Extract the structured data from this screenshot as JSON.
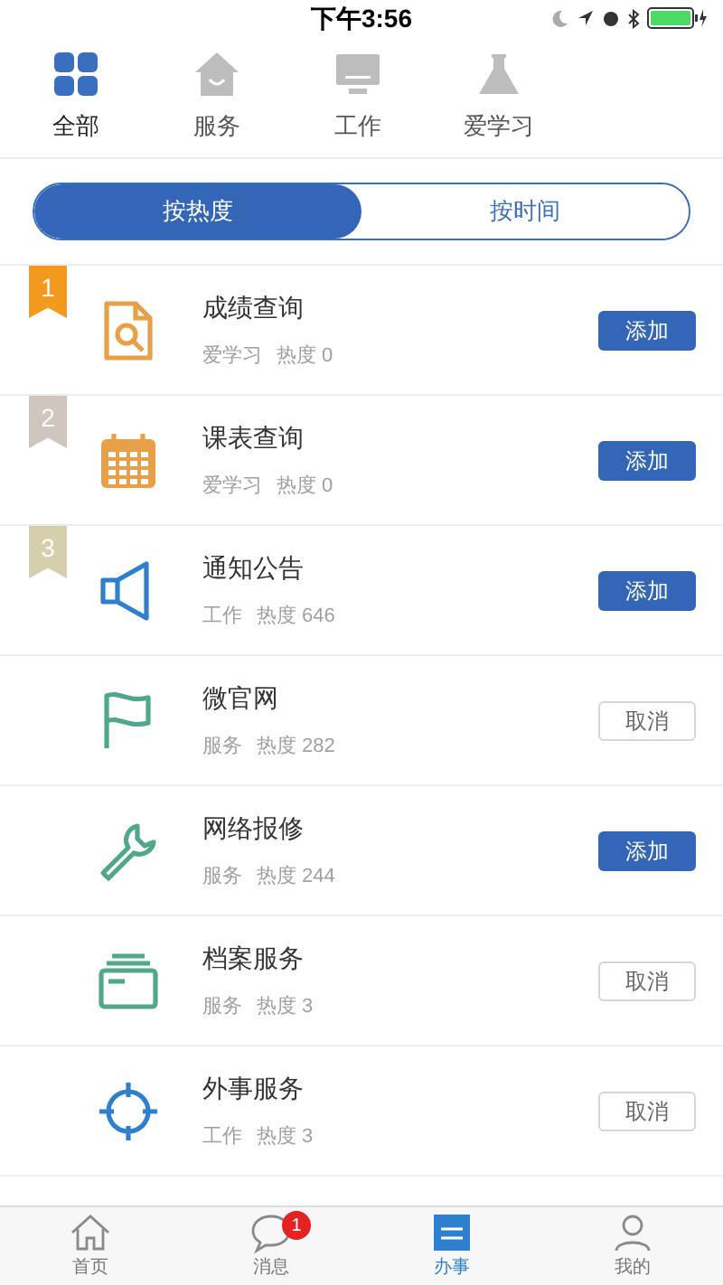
{
  "status_bar": {
    "time": "下午3:56"
  },
  "categories": [
    {
      "label": "全部",
      "kind": "grid",
      "selected": true
    },
    {
      "label": "服务",
      "kind": "house",
      "selected": false
    },
    {
      "label": "工作",
      "kind": "monitor",
      "selected": false
    },
    {
      "label": "爱学习",
      "kind": "flask",
      "selected": false
    }
  ],
  "sort_tabs": [
    {
      "label": "按热度",
      "selected": true
    },
    {
      "label": "按时间",
      "selected": false
    }
  ],
  "items": [
    {
      "rank": {
        "label": "1",
        "color": "#f39a1e"
      },
      "kind": "doc-search",
      "color": "#e8a048",
      "title": "成绩查询",
      "category": "爱学习",
      "heat": "热度 0",
      "button": {
        "label": "添加",
        "added": false
      }
    },
    {
      "rank": {
        "label": "2",
        "color": "#cfc7bd"
      },
      "kind": "calendar",
      "color": "#e8a048",
      "title": "课表查询",
      "category": "爱学习",
      "heat": "热度 0",
      "button": {
        "label": "添加",
        "added": false
      }
    },
    {
      "rank": {
        "label": "3",
        "color": "#d6cfae"
      },
      "kind": "speaker",
      "color": "#2f7fcf",
      "title": "通知公告",
      "category": "工作",
      "heat": "热度 646",
      "button": {
        "label": "添加",
        "added": false
      }
    },
    {
      "kind": "flag",
      "color": "#4fa88a",
      "title": "微官网",
      "category": "服务",
      "heat": "热度 282",
      "button": {
        "label": "取消",
        "added": true
      }
    },
    {
      "kind": "wrench",
      "color": "#4fa88a",
      "title": "网络报修",
      "category": "服务",
      "heat": "热度 244",
      "button": {
        "label": "添加",
        "added": false
      }
    },
    {
      "kind": "archive",
      "color": "#4fa88a",
      "title": "档案服务",
      "category": "服务",
      "heat": "热度 3",
      "button": {
        "label": "取消",
        "added": true
      }
    },
    {
      "kind": "crosshair",
      "color": "#2f7fcf",
      "title": "外事服务",
      "category": "工作",
      "heat": "热度 3",
      "button": {
        "label": "取消",
        "added": true
      }
    }
  ],
  "tab_bar": [
    {
      "label": "首页",
      "kind": "home",
      "selected": false
    },
    {
      "label": "消息",
      "kind": "chat",
      "selected": false,
      "badge": "1"
    },
    {
      "label": "办事",
      "kind": "tasks",
      "selected": true
    },
    {
      "label": "我的",
      "kind": "person",
      "selected": false
    }
  ]
}
